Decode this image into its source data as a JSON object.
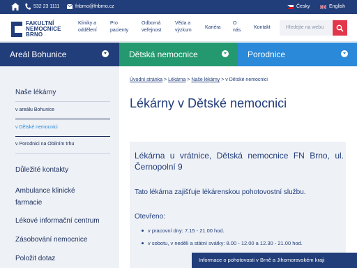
{
  "topbar": {
    "phone": "532 23 1111",
    "email": "fnbrno@fnbrno.cz",
    "lang_cs": "Česky",
    "lang_en": "English"
  },
  "logo": {
    "line1": "FAKULTNÍ",
    "line2": "NEMOCNICE",
    "line3": "BRNO"
  },
  "nav": [
    {
      "l1": "Kliniky a",
      "l2": "oddělení"
    },
    {
      "l1": "Pro",
      "l2": "pacienty"
    },
    {
      "l1": "Odborná",
      "l2": "veřejnost"
    },
    {
      "l1": "Věda a",
      "l2": "výzkum"
    },
    {
      "l1": "Kariéra",
      "l2": ""
    },
    {
      "l1": "O",
      "l2": "nás"
    },
    {
      "l1": "Kontakt",
      "l2": ""
    }
  ],
  "search": {
    "placeholder": "Hledejte na webu"
  },
  "tabs": [
    {
      "label": "Areál Bohunice",
      "color": "#213d7a"
    },
    {
      "label": "Dětská nemocnice",
      "color": "#24996f"
    },
    {
      "label": "Porodnice",
      "color": "#2a89d8"
    }
  ],
  "sidebar": {
    "heading": "Naše lékárny",
    "subitems": [
      "v areálu Bohunice",
      "v Dětské nemocnici",
      "v Porodnici na Obilním trhu"
    ],
    "items": [
      {
        "l1": "Důležité kontakty",
        "l2": ""
      },
      {
        "l1": "Ambulance klinické",
        "l2": "farmacie"
      },
      {
        "l1": "Lékové informační centrum",
        "l2": ""
      },
      {
        "l1": "Zásobování nemocnice",
        "l2": ""
      },
      {
        "l1": "Položit dotaz",
        "l2": ""
      }
    ]
  },
  "breadcrumb": {
    "items": [
      "Úvodní stránka",
      "Lékárna",
      "Naše lékárny",
      "v Dětské nemocnici"
    ],
    "separator": ">"
  },
  "page_title": "Lékárny v Dětské nemocnici",
  "card": {
    "title": "Lékárna u vrátnice, Dětská nemocnice FN Brno, ul. Černopolní 9",
    "desc": "Tato lékárna zajišťuje lékárenskou pohotovostní službu.",
    "hours_heading": "Otevřeno:",
    "hours": [
      "v pracovní dny: 7.15 - 21.00 hod.",
      "v sobotu, v neděli a státní svátky: 8.00 - 12.00 a 12.30 - 21.00 hod."
    ]
  },
  "banner": "Informace o pohotovosti v Brně a Jihomoravském kraji"
}
